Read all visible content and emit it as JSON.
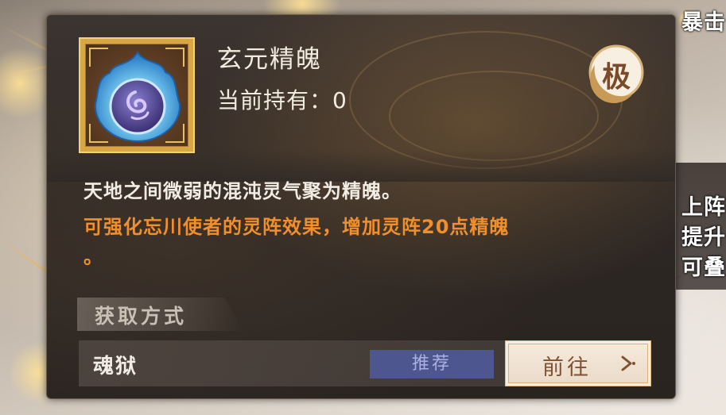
{
  "item": {
    "name": "玄元精魄",
    "holding_label": "当前持有：",
    "holding_value": "0",
    "grade": "极",
    "icon": "spirit-orb-icon"
  },
  "description": {
    "line1": "天地之间微弱的混沌灵气聚为精魄。",
    "line2": "可强化忘川使者的灵阵效果，增加灵阵20点精魄",
    "line2_end": "。"
  },
  "sources": {
    "title": "获取方式",
    "rows": [
      {
        "name": "魂狱",
        "tag": "推荐",
        "button": "前往"
      }
    ]
  },
  "background": {
    "right_text_top": "暴击",
    "right_text_lines": [
      "上阵",
      "提升",
      "可叠"
    ]
  },
  "colors": {
    "accent_orange": "#f08f2c",
    "recommend_bg": "#4e5690",
    "frame_gold": "#d8a743"
  }
}
